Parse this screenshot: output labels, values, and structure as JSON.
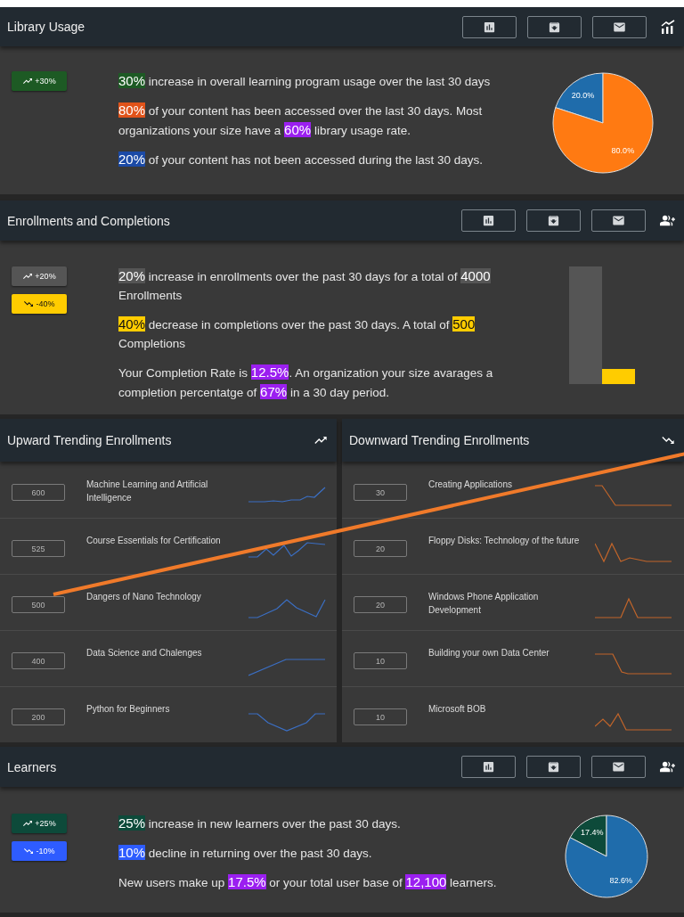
{
  "library_usage": {
    "title": "Library Usage",
    "header_icon": {
      "kind": "growth-chart"
    },
    "badges": [
      {
        "label": "+30%",
        "kind": "up",
        "color": "#1d5a24"
      }
    ],
    "paragraphs": [
      [
        {
          "text": "30%",
          "color": "#1d5a24"
        },
        {
          "text": " increase in overall learning program usage over the last 30 days"
        }
      ],
      [
        {
          "text": "80%",
          "color": "#e0531a"
        },
        {
          "text": " of your content has been accessed over the last 30 days. Most organizations your size have a "
        },
        {
          "text": "60%",
          "color": "#9b1ff0"
        },
        {
          "text": " library usage rate."
        }
      ],
      [
        {
          "text": "20%",
          "color": "#1b4aa6"
        },
        {
          "text": " of your content has not been accessed during the last 30 days."
        }
      ]
    ],
    "chart_data": {
      "type": "pie",
      "values": [
        20.0,
        80.0
      ],
      "value_labels": [
        "20.0%",
        "80.0%"
      ],
      "colors": [
        "#1f6cab",
        "#ff7a12"
      ]
    }
  },
  "enrollments": {
    "title": "Enrollments and Completions",
    "header_icon": {
      "kind": "add-user"
    },
    "figure": {
      "kind": "bars"
    },
    "badges": [
      {
        "label": "+20%",
        "kind": "up",
        "color": "#555555"
      },
      {
        "label": "-40%",
        "kind": "down",
        "color": "#ffcc00"
      }
    ],
    "paragraphs": [
      [
        {
          "text": "20%",
          "color": "#555555"
        },
        {
          "text": " increase in enrollments over the past 30 days for a total of "
        },
        {
          "text": "4000",
          "color": "#555555"
        },
        {
          "text": " Enrollments"
        }
      ],
      [
        {
          "text": "40%",
          "color": "#ffcc00"
        },
        {
          "text": " decrease in completions over the past 30 days. A total of "
        },
        {
          "text": "500",
          "color": "#ffcc00"
        },
        {
          "text": " Completions"
        }
      ],
      [
        {
          "text": "Your Completion Rate is "
        },
        {
          "text": "12.5%",
          "color": "#9b1ff0"
        },
        {
          "text": ". An organization your size avarages a completion percentatge of "
        },
        {
          "text": "67%",
          "color": "#9b1ff0"
        },
        {
          "text": " in a 30 day period."
        }
      ]
    ]
  },
  "trending": [
    {
      "title": "Upward Trending Enrollments",
      "kind": "up",
      "rows": [
        {
          "count": "600",
          "title": "Machine Learning and Artificial Intelligence"
        },
        {
          "count": "525",
          "title": "Course Essentials for Certification"
        },
        {
          "count": "500",
          "title": "Dangers of Nano Technology"
        },
        {
          "count": "400",
          "title": "Data Science and Chalenges"
        },
        {
          "count": "200",
          "title": "Python for Beginners"
        }
      ]
    },
    {
      "title": "Downward Trending Enrollments",
      "kind": "down",
      "rows": [
        {
          "count": "30",
          "title": "Creating Applications"
        },
        {
          "count": "20",
          "title": "Floppy Disks: Technology of the future"
        },
        {
          "count": "20",
          "title": "Windows Phone Application Development"
        },
        {
          "count": "10",
          "title": "Building your own Data Center"
        },
        {
          "count": "10",
          "title": "Microsoft BOB"
        }
      ]
    }
  ],
  "learners": {
    "title": "Learners",
    "header_icon": {
      "kind": "add-user"
    },
    "badges": [
      {
        "label": "+25%",
        "kind": "up",
        "color": "#0d4a3a"
      },
      {
        "label": "-10%",
        "kind": "down",
        "color": "#2e5cff"
      }
    ],
    "paragraphs": [
      [
        {
          "text": "25%",
          "color": "#0d4a3a"
        },
        {
          "text": " increase in new learners over the past 30 days."
        }
      ],
      [
        {
          "text": "10%",
          "color": "#2e5cff"
        },
        {
          "text": " decline in returning over the past 30 days."
        }
      ],
      [
        {
          "text": "New users make up "
        },
        {
          "text": "17.5%",
          "color": "#9b1ff0"
        },
        {
          "text": " or your total user base of "
        },
        {
          "text": "12,100",
          "color": "#9b1ff0"
        },
        {
          "text": " learners."
        }
      ]
    ],
    "chart_data": {
      "type": "pie",
      "values": [
        17.4,
        82.6
      ],
      "value_labels": [
        "17.4%",
        "82.6%"
      ],
      "colors": [
        "#0d4a3a",
        "#1f6cab"
      ]
    }
  }
}
